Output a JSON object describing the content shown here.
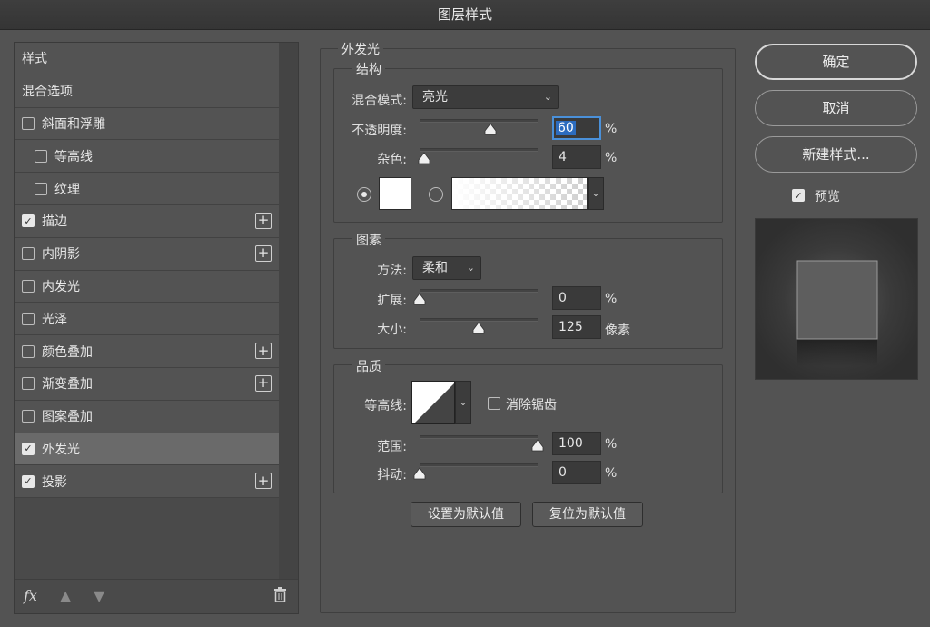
{
  "window": {
    "title": "图层样式"
  },
  "left_panel": {
    "items": [
      {
        "label": "样式",
        "checkbox": false
      },
      {
        "label": "混合选项",
        "checkbox": false
      },
      {
        "label": "斜面和浮雕",
        "checkbox": true,
        "checked": false,
        "plus": false
      },
      {
        "label": "等高线",
        "checkbox": true,
        "checked": false,
        "indent": true
      },
      {
        "label": "纹理",
        "checkbox": true,
        "checked": false,
        "indent": true
      },
      {
        "label": "描边",
        "checkbox": true,
        "checked": true,
        "plus": true
      },
      {
        "label": "内阴影",
        "checkbox": true,
        "checked": false,
        "plus": true
      },
      {
        "label": "内发光",
        "checkbox": true,
        "checked": false
      },
      {
        "label": "光泽",
        "checkbox": true,
        "checked": false
      },
      {
        "label": "颜色叠加",
        "checkbox": true,
        "checked": false,
        "plus": true
      },
      {
        "label": "渐变叠加",
        "checkbox": true,
        "checked": false,
        "plus": true
      },
      {
        "label": "图案叠加",
        "checkbox": true,
        "checked": false
      },
      {
        "label": "外发光",
        "checkbox": true,
        "checked": true,
        "selected": true
      },
      {
        "label": "投影",
        "checkbox": true,
        "checked": true,
        "plus": true
      }
    ],
    "footer": {
      "fx": "fx",
      "up_icon": "arrow-up-icon",
      "down_icon": "arrow-down-icon",
      "trash_icon": "trash-icon"
    }
  },
  "outer_glow": {
    "title": "外发光",
    "structure": {
      "title": "结构",
      "blend_mode_label": "混合模式:",
      "blend_mode_value": "亮光",
      "opacity_label": "不透明度:",
      "opacity_value": "60",
      "opacity_unit": "%",
      "noise_label": "杂色:",
      "noise_value": "4",
      "noise_unit": "%"
    },
    "elements": {
      "title": "图素",
      "technique_label": "方法:",
      "technique_value": "柔和",
      "spread_label": "扩展:",
      "spread_value": "0",
      "spread_unit": "%",
      "size_label": "大小:",
      "size_value": "125",
      "size_unit": "像素"
    },
    "quality": {
      "title": "品质",
      "contour_label": "等高线:",
      "antialias_label": "消除锯齿",
      "range_label": "范围:",
      "range_value": "100",
      "range_unit": "%",
      "jitter_label": "抖动:",
      "jitter_value": "0",
      "jitter_unit": "%"
    },
    "make_default": "设置为默认值",
    "reset_default": "复位为默认值"
  },
  "right": {
    "ok": "确定",
    "cancel": "取消",
    "new_style": "新建样式...",
    "preview_label": "预览"
  },
  "sliders": {
    "opacity": 0.6,
    "noise": 0.04,
    "spread": 0.0,
    "size": 0.5,
    "range": 1.0,
    "jitter": 0.0
  }
}
